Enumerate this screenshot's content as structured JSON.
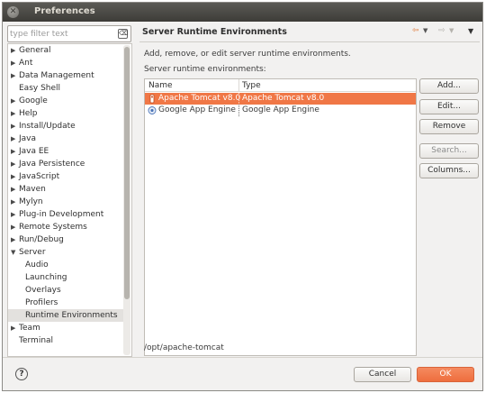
{
  "window": {
    "title": "Preferences"
  },
  "filter": {
    "placeholder": "type filter text"
  },
  "tree": {
    "items": [
      {
        "label": "General",
        "expander": "▶"
      },
      {
        "label": "Ant",
        "expander": "▶"
      },
      {
        "label": "Data Management",
        "expander": "▶"
      },
      {
        "label": "Easy Shell",
        "expander": ""
      },
      {
        "label": "Google",
        "expander": "▶"
      },
      {
        "label": "Help",
        "expander": "▶"
      },
      {
        "label": "Install/Update",
        "expander": "▶"
      },
      {
        "label": "Java",
        "expander": "▶"
      },
      {
        "label": "Java EE",
        "expander": "▶"
      },
      {
        "label": "Java Persistence",
        "expander": "▶"
      },
      {
        "label": "JavaScript",
        "expander": "▶"
      },
      {
        "label": "Maven",
        "expander": "▶"
      },
      {
        "label": "Mylyn",
        "expander": "▶"
      },
      {
        "label": "Plug-in Development",
        "expander": "▶"
      },
      {
        "label": "Remote Systems",
        "expander": "▶"
      },
      {
        "label": "Run/Debug",
        "expander": "▶"
      },
      {
        "label": "Server",
        "expander": "▼"
      },
      {
        "label": "Audio",
        "expander": ""
      },
      {
        "label": "Launching",
        "expander": ""
      },
      {
        "label": "Overlays",
        "expander": ""
      },
      {
        "label": "Profilers",
        "expander": ""
      },
      {
        "label": "Runtime Environments",
        "expander": ""
      },
      {
        "label": "Team",
        "expander": "▶"
      },
      {
        "label": "Terminal",
        "expander": ""
      }
    ]
  },
  "page": {
    "title": "Server Runtime Environments",
    "description": "Add, remove, or edit server runtime environments.",
    "list_label": "Server runtime environments:",
    "columns": {
      "name": "Name",
      "type": "Type"
    },
    "rows": [
      {
        "name": "Apache Tomcat v8.0",
        "type": "Apache Tomcat v8.0",
        "icon": "tomcat-icon"
      },
      {
        "name": "Google App Engine",
        "type": "Google App Engine",
        "icon": "google-app-engine-icon"
      }
    ],
    "location": "/opt/apache-tomcat"
  },
  "buttons": {
    "add": "Add...",
    "edit": "Edit...",
    "remove": "Remove",
    "search": "Search...",
    "columns": "Columns..."
  },
  "footer": {
    "cancel": "Cancel",
    "ok": "OK",
    "help": "?"
  },
  "colors": {
    "accent": "#f07746",
    "titlebar": "#3d3c38"
  }
}
